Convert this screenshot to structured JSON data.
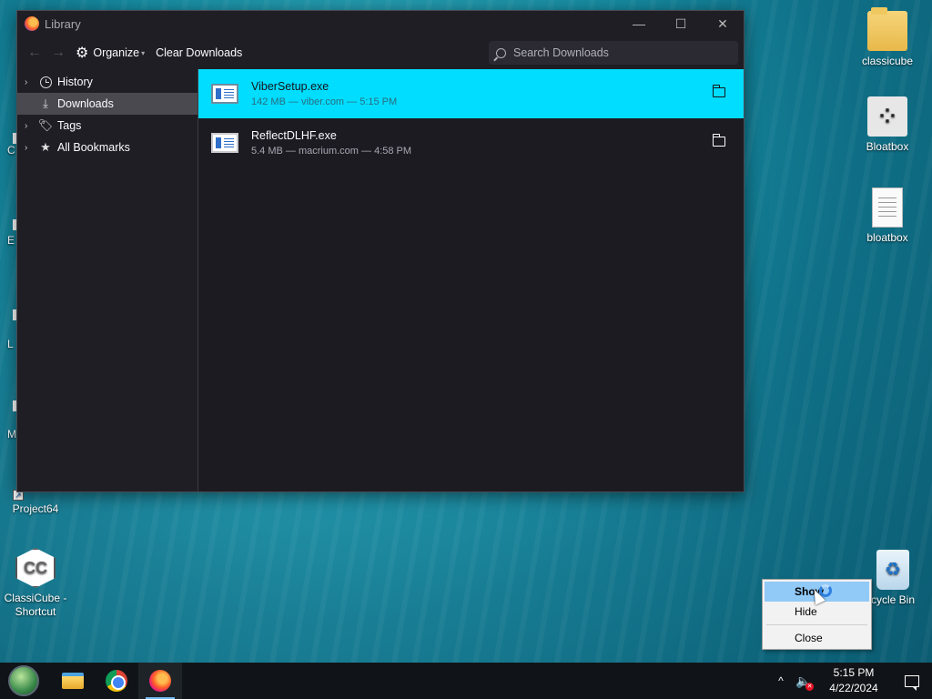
{
  "window": {
    "title": "Library",
    "controls": {
      "minimize": "—",
      "maximize": "☐",
      "close": "✕"
    }
  },
  "toolbar": {
    "back_icon": "arrow-left-icon",
    "forward_icon": "arrow-right-icon",
    "organize_label": "Organize",
    "clear_label": "Clear Downloads",
    "search_placeholder": "Search Downloads"
  },
  "sidebar": {
    "items": [
      {
        "label": "History",
        "icon": "clock-icon",
        "expandable": true
      },
      {
        "label": "Downloads",
        "icon": "download-icon",
        "selected": true
      },
      {
        "label": "Tags",
        "icon": "tag-icon",
        "expandable": true
      },
      {
        "label": "All Bookmarks",
        "icon": "star-icon",
        "expandable": true
      }
    ]
  },
  "downloads": [
    {
      "name": "ViberSetup.exe",
      "meta": "142 MB — viber.com — 5:15 PM",
      "selected": true
    },
    {
      "name": "ReflectDLHF.exe",
      "meta": "5.4 MB — macrium.com — 4:58 PM",
      "selected": false
    }
  ],
  "desktop": {
    "icons": [
      {
        "label": "classicube"
      },
      {
        "label": "Bloatbox"
      },
      {
        "label": "bloatbox"
      },
      {
        "label": "Project64"
      },
      {
        "label": "ClassiCube - Shortcut"
      },
      {
        "label": "cycle Bin"
      }
    ],
    "edge_labels": [
      "C",
      "E",
      "L",
      "M"
    ]
  },
  "context_menu": {
    "items": [
      "Show",
      "Hide",
      "Close"
    ],
    "highlighted": "Show"
  },
  "taskbar": {
    "time": "5:15 PM",
    "date": "4/22/2024",
    "tray_chevron": "^"
  },
  "colors": {
    "selection_accent": "#00ddff",
    "window_bg": "#1c1b22",
    "menu_highlight": "#91c9f7"
  }
}
